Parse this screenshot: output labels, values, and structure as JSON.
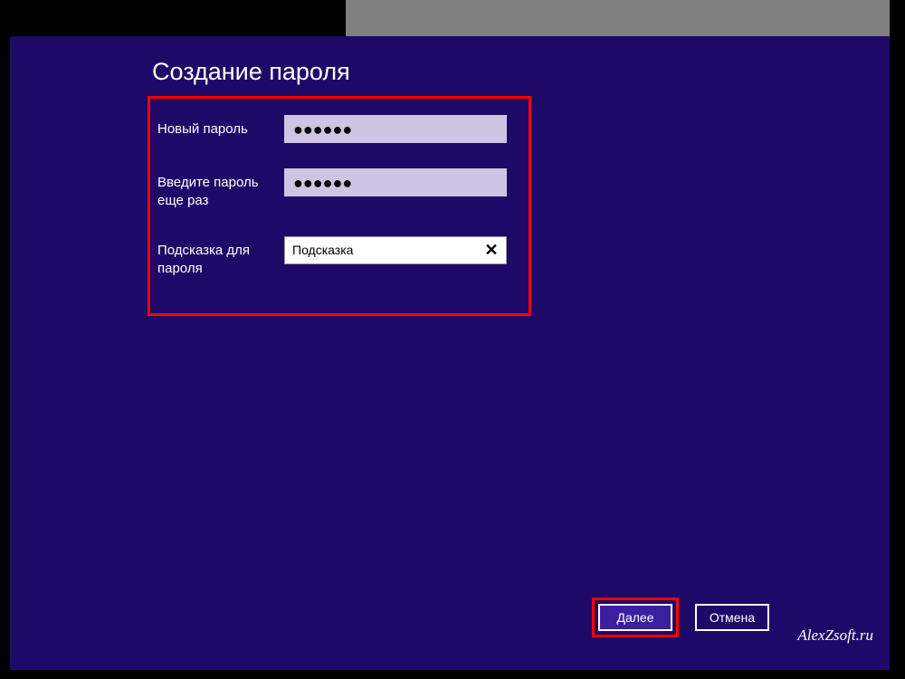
{
  "title": "Создание пароля",
  "form": {
    "new_password": {
      "label": "Новый пароль",
      "value": "●●●●●●"
    },
    "confirm_password": {
      "label": "Введите пароль еще раз",
      "value": "●●●●●●"
    },
    "hint": {
      "label": "Подсказка для пароля",
      "value": "Подсказка"
    }
  },
  "buttons": {
    "next": "Далее",
    "cancel": "Отмена"
  },
  "watermark": "AlexZsoft.ru"
}
